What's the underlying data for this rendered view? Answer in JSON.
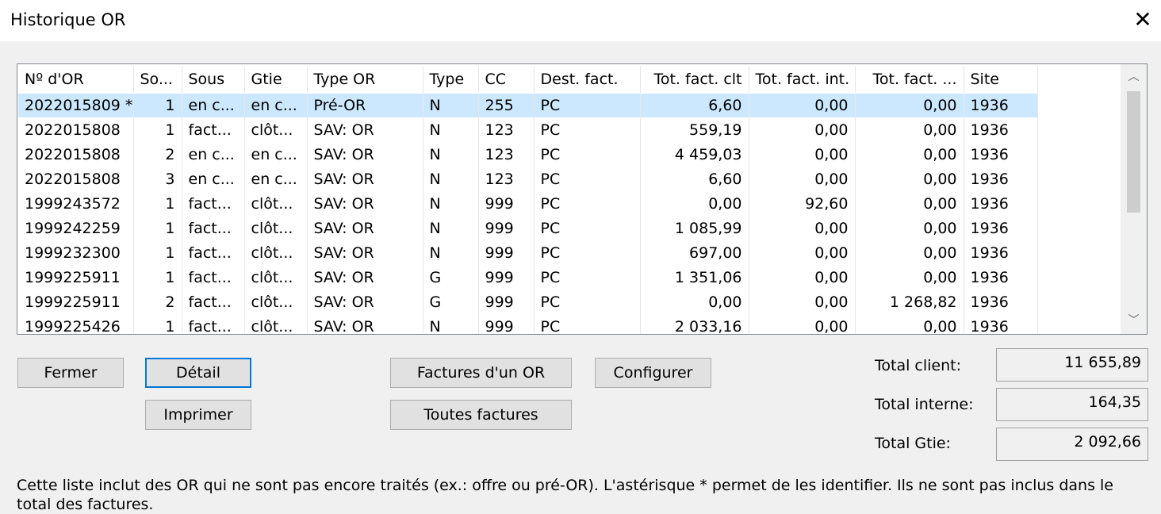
{
  "window": {
    "title": "Historique OR"
  },
  "table": {
    "columns": [
      "Nº d'OR",
      "So...",
      "Sous",
      "Gtie",
      "Type OR",
      "Type",
      "CC",
      "Dest. fact.",
      "Tot. fact. clt",
      "Tot. fact. int.",
      "Tot. fact. ...",
      "Site"
    ],
    "rows": [
      [
        "2022015809 *",
        "1",
        "en c...",
        "en c...",
        "Pré-OR",
        "N",
        "255",
        "PC",
        "6,60",
        "0,00",
        "0,00",
        "1936"
      ],
      [
        "2022015808",
        "1",
        "fact...",
        "clôt...",
        "SAV: OR",
        "N",
        "123",
        "PC",
        "559,19",
        "0,00",
        "0,00",
        "1936"
      ],
      [
        "2022015808",
        "2",
        "en c...",
        "en c...",
        "SAV: OR",
        "N",
        "123",
        "PC",
        "4 459,03",
        "0,00",
        "0,00",
        "1936"
      ],
      [
        "2022015808",
        "3",
        "en c...",
        "en c...",
        "SAV: OR",
        "N",
        "123",
        "PC",
        "6,60",
        "0,00",
        "0,00",
        "1936"
      ],
      [
        "1999243572",
        "1",
        "fact...",
        "clôt...",
        "SAV: OR",
        "N",
        "999",
        "PC",
        "0,00",
        "92,60",
        "0,00",
        "1936"
      ],
      [
        "1999242259",
        "1",
        "fact...",
        "clôt...",
        "SAV: OR",
        "N",
        "999",
        "PC",
        "1 085,99",
        "0,00",
        "0,00",
        "1936"
      ],
      [
        "1999232300",
        "1",
        "fact...",
        "clôt...",
        "SAV: OR",
        "N",
        "999",
        "PC",
        "697,00",
        "0,00",
        "0,00",
        "1936"
      ],
      [
        "1999225911",
        "1",
        "fact...",
        "clôt...",
        "SAV: OR",
        "G",
        "999",
        "PC",
        "1 351,06",
        "0,00",
        "0,00",
        "1936"
      ],
      [
        "1999225911",
        "2",
        "fact...",
        "clôt...",
        "SAV: OR",
        "G",
        "999",
        "PC",
        "0,00",
        "0,00",
        "1 268,82",
        "1936"
      ],
      [
        "1999225426",
        "1",
        "fact...",
        "clôt...",
        "SAV: OR",
        "N",
        "999",
        "PC",
        "2 033,16",
        "0,00",
        "0,00",
        "1936"
      ]
    ],
    "selected_row": 0
  },
  "buttons": {
    "fermer": "Fermer",
    "detail": "Détail",
    "imprimer": "Imprimer",
    "factures_or": "Factures d'un OR",
    "toutes_factures": "Toutes factures",
    "configurer": "Configurer"
  },
  "totals": {
    "client_label": "Total client:",
    "client_value": "11 655,89",
    "interne_label": "Total interne:",
    "interne_value": "164,35",
    "gtie_label": "Total Gtie:",
    "gtie_value": "2 092,66"
  },
  "note": "Cette liste inclut des OR qui ne sont pas encore traités (ex.: offre ou pré-OR). L'astérisque * permet de les identifier. Ils ne sont pas inclus dans le total des factures.",
  "icons": {
    "close": "close-icon",
    "scroll_up": "chevron-up-icon",
    "scroll_down": "chevron-down-icon"
  },
  "colors": {
    "selection": "#cce8ff",
    "default_button_border": "#0078d7",
    "background": "#f0f0f0"
  }
}
